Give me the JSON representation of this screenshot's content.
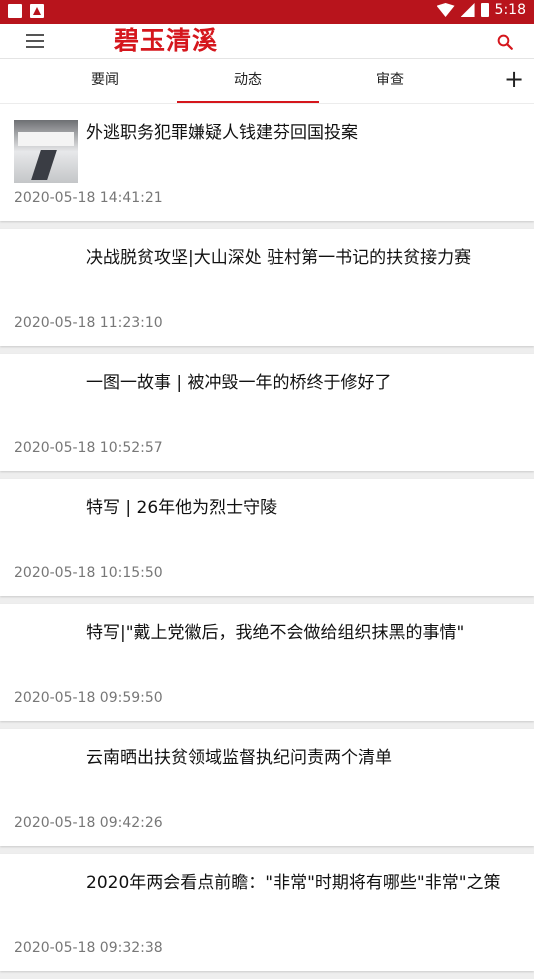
{
  "status_bar": {
    "time": "5:18"
  },
  "app": {
    "logo_text": "碧玉清溪"
  },
  "tabs": [
    {
      "label": "要闻",
      "active": false
    },
    {
      "label": "动态",
      "active": true
    },
    {
      "label": "审查",
      "active": false
    }
  ],
  "add_tab_label": "+",
  "articles": [
    {
      "title": "外逃职务犯罪嫌疑人钱建芬回国投案",
      "time": "2020-05-18 14:41:21",
      "has_image": true
    },
    {
      "title": "决战脱贫攻坚|大山深处 驻村第一书记的扶贫接力赛",
      "time": "2020-05-18 11:23:10",
      "has_image": false
    },
    {
      "title": "一图一故事 | 被冲毁一年的桥终于修好了",
      "time": "2020-05-18 10:52:57",
      "has_image": false
    },
    {
      "title": "特写 | 26年他为烈士守陵",
      "time": "2020-05-18 10:15:50",
      "has_image": false
    },
    {
      "title": "特写|\"戴上党徽后，我绝不会做给组织抹黑的事情\"",
      "time": "2020-05-18 09:59:50",
      "has_image": false
    },
    {
      "title": "云南晒出扶贫领域监督执纪问责两个清单",
      "time": "2020-05-18 09:42:26",
      "has_image": false
    },
    {
      "title": "2020年两会看点前瞻：\"非常\"时期将有哪些\"非常\"之策",
      "time": "2020-05-18 09:32:38",
      "has_image": false
    }
  ],
  "colors": {
    "brand": "#d5161c",
    "status_bar": "#b8141c"
  }
}
